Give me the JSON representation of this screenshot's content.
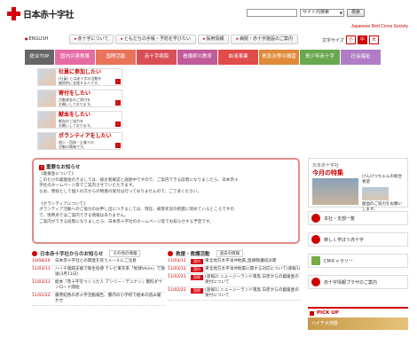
{
  "header": {
    "logo_text": "日本赤十字社",
    "site_select": "サイト内検索",
    "search_button": "検索",
    "english_name": "Japanese Red Cross Society",
    "english_link": "ENGLISH"
  },
  "topnav": [
    "赤十字について",
    "ともだちの手帳・予防を学びたい",
    "採用情報",
    "病院・赤十字施設のご案内"
  ],
  "font_size": {
    "label": "文字サイズ",
    "options": [
      "小",
      "中",
      "大"
    ],
    "selected": "中"
  },
  "mainnav": {
    "items": [
      "総合TOP",
      "国内災害救護",
      "国際活動",
      "赤十字病院",
      "看護師の教育",
      "血液事業",
      "救急法等の講習",
      "青少年赤十字",
      "社会福祉"
    ],
    "colors": [
      "#666666",
      "#e66ba3",
      "#e8745a",
      "#d94f57",
      "#c25b9a",
      "#e04b4b",
      "#e08a3b",
      "#6aa84f",
      "#b07cc6"
    ]
  },
  "promos": [
    {
      "title": "社員に参加したい",
      "sub1": "(社員) とは赤十字の活動を",
      "sub2": "継続的に支援する人です。"
    },
    {
      "title": "寄付をしたい",
      "sub1": "活動資金のご寄付を",
      "sub2": "お願いしております。"
    },
    {
      "title": "献血をしたい",
      "sub1": "献血のご協力を",
      "sub2": "お願いしております。"
    },
    {
      "title": "ボランティアをしたい",
      "sub1": "個人・団体・企業での",
      "sub2": "活動の情報です。"
    }
  ],
  "notice": {
    "title": "重要なお知らせ",
    "lines": [
      "《義援金について》",
      "このたびの義援金のきましては、被災者確認と調査中ですので、ご案内できる段階になりましたら、日本赤十",
      "字社のホームページ等でご案内させていただきます。",
      "なお、原則として個人の方からの物資の受付は行っておりませんので、ご了承ください。",
      "",
      "《ボランティアについて》",
      "ボランティア活動へのご協力のお申し出につきましては、現在、被害状況の把握に努めているところですの",
      "で、現時点ではご案内できる情報はありません。",
      "ご案内ができる段階になりましたら、日本赤十字社のホームページ等でお知らせする予定です。"
    ]
  },
  "right": {
    "monthly_tag": "日本赤十字社",
    "monthly_title": "今月の特集",
    "side_text": "けんけつちゃんの総合希望",
    "side_text2": "献血のご協力をお願いします。",
    "links": [
      "本社・支部一覧",
      "楽しく学ぼう赤十字",
      "CMギャラリー",
      "赤十字情報プラザのご案内"
    ],
    "pickup_title": "PICK UP",
    "pickup_banner": "ハイチ大地震"
  },
  "news": {
    "title": "日本赤十字社からのお知らせ",
    "past_link": "その他の情報",
    "rows": [
      {
        "date": "10/08/26",
        "text": "日本赤十字社との関連を装うメールにご注意"
      },
      {
        "date": "11/03/11",
        "text": "ハイチ復興支援で衛生指導 テレビ東京系「地球Voice」で放送(3月11日)"
      },
      {
        "date": "11/03/11",
        "text": "絵本「赤十字をつくった人 アンリー・デュナン」無料ダウンロード開始"
      },
      {
        "date": "11/02/22",
        "text": "藤原紀香の赤十字活動報告、都内の小学校で絵本の読み聞かせ"
      }
    ]
  },
  "relief": {
    "title": "救援・救護活動",
    "past_link": "過去の情報",
    "rows": [
      {
        "date": "11/03/12",
        "tag": "国内",
        "text": "東北地方太平洋沖地震_医療救護班派遣"
      },
      {
        "date": "11/03/12",
        "tag": "国内",
        "text": "東北地方太平洋沖地震に関する対応について(速報1)"
      },
      {
        "date": "11/02/23",
        "tag": "国際",
        "text": "(速報2) ニュージーランド南島 日赤からの義援金の受付について"
      },
      {
        "date": "11/02/22",
        "tag": "国際",
        "text": "(速報1) ニュージーランド南島 日赤からの義援金の受付について"
      }
    ]
  }
}
